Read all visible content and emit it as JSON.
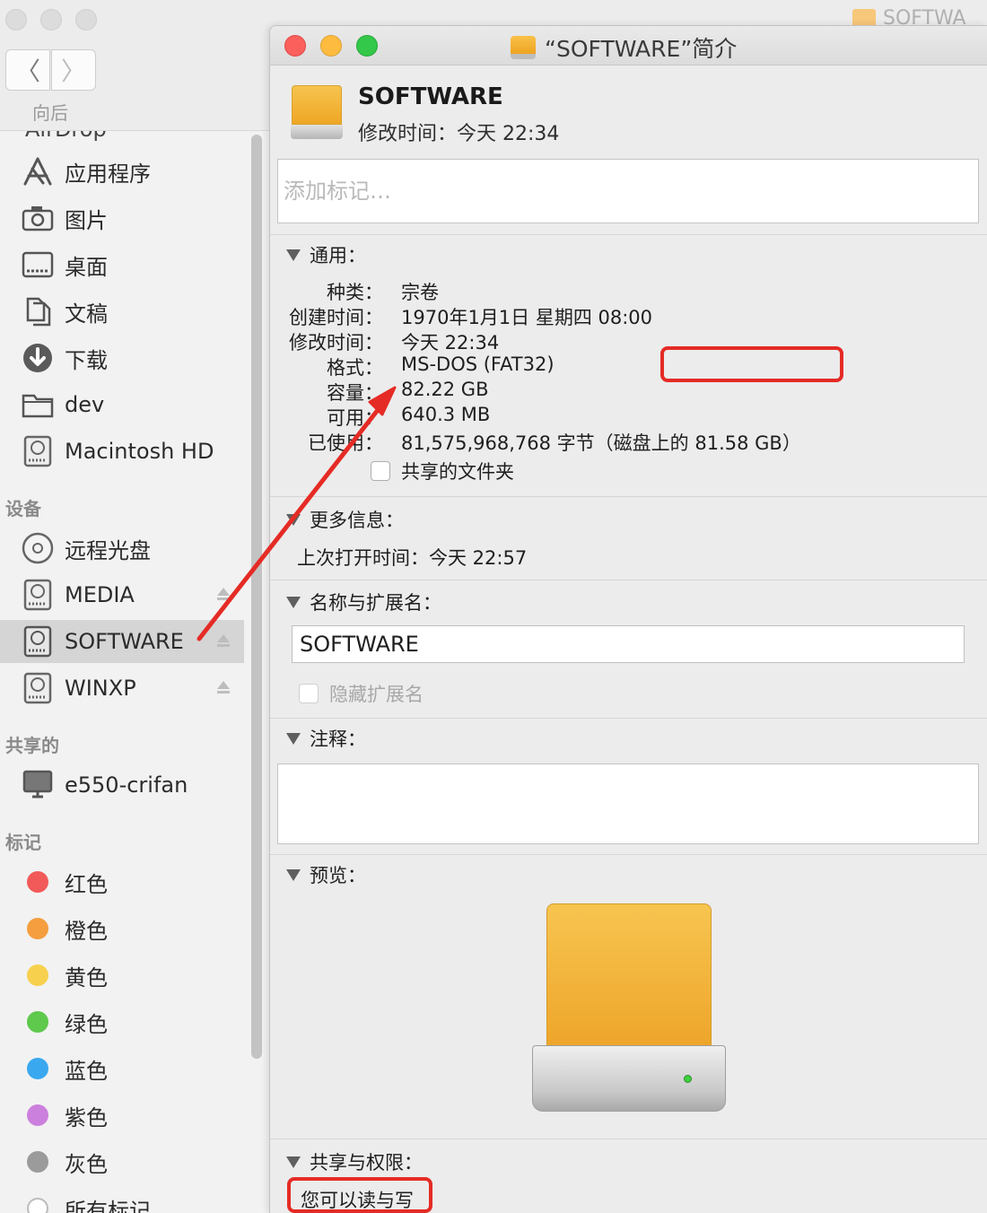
{
  "finder": {
    "title": "SOFTWA",
    "back_label": "向后",
    "back_glyph": "〈",
    "forward_glyph": "〉",
    "partial_item": "AirDrop",
    "favorites": [
      {
        "label": "应用程序",
        "icon": "applications-icon"
      },
      {
        "label": "图片",
        "icon": "camera-icon"
      },
      {
        "label": "桌面",
        "icon": "desktop-icon"
      },
      {
        "label": "文稿",
        "icon": "documents-icon"
      },
      {
        "label": "下载",
        "icon": "download-icon"
      },
      {
        "label": "dev",
        "icon": "folder-icon"
      },
      {
        "label": "Macintosh HD",
        "icon": "hard-disk-icon"
      }
    ],
    "devices_header": "设备",
    "devices": [
      {
        "label": "远程光盘",
        "icon": "optical-disc-icon"
      },
      {
        "label": "MEDIA",
        "icon": "disk-icon"
      },
      {
        "label": "SOFTWARE",
        "icon": "disk-icon"
      },
      {
        "label": "WINXP",
        "icon": "disk-icon"
      }
    ],
    "shared_header": "共享的",
    "shared": [
      {
        "label": "e550-crifan",
        "icon": "computer-icon"
      }
    ],
    "tags_header": "标记",
    "tags": [
      {
        "label": "红色",
        "color": "#f25a5a"
      },
      {
        "label": "橙色",
        "color": "#f59e3f"
      },
      {
        "label": "黄色",
        "color": "#f7d04e"
      },
      {
        "label": "绿色",
        "color": "#5ec94c"
      },
      {
        "label": "蓝色",
        "color": "#3aa8ef"
      },
      {
        "label": "紫色",
        "color": "#cc80dd"
      },
      {
        "label": "灰色",
        "color": "#9b9b9b"
      }
    ],
    "partial_tag": "所有标记"
  },
  "info": {
    "title": "“SOFTWARE”简介",
    "name": "SOFTWARE",
    "modified_header": "修改时间：今天 22:34",
    "tag_placeholder": "添加标记…",
    "general": {
      "header": "通用：",
      "rows": [
        {
          "k": "种类：",
          "v": "宗卷"
        },
        {
          "k": "创建时间：",
          "v": "1970年1月1日 星期四 08:00"
        },
        {
          "k": "修改时间：",
          "v": "今天 22:34"
        },
        {
          "k": "格式：",
          "v": "MS-DOS (FAT32)"
        },
        {
          "k": "容量：",
          "v": "82.22 GB"
        },
        {
          "k": "可用：",
          "v": "640.3 MB"
        },
        {
          "k": "已使用：",
          "v": "81,575,968,768 字节（磁盘上的 81.58 GB）"
        }
      ],
      "shared_folder": "共享的文件夹"
    },
    "more": {
      "header": "更多信息：",
      "last_opened": "上次打开时间：今天 22:57"
    },
    "name_ext": {
      "header": "名称与扩展名：",
      "value": "SOFTWARE",
      "hide_ext": "隐藏扩展名"
    },
    "comments": {
      "header": "注释："
    },
    "preview": {
      "header": "预览："
    },
    "sharing": {
      "header": "共享与权限：",
      "status": "您可以读与写"
    }
  },
  "colors": {
    "annotation_red": "#e52b25",
    "close": "#fc605c",
    "minimize": "#fdbc40",
    "zoom": "#34c84a"
  }
}
